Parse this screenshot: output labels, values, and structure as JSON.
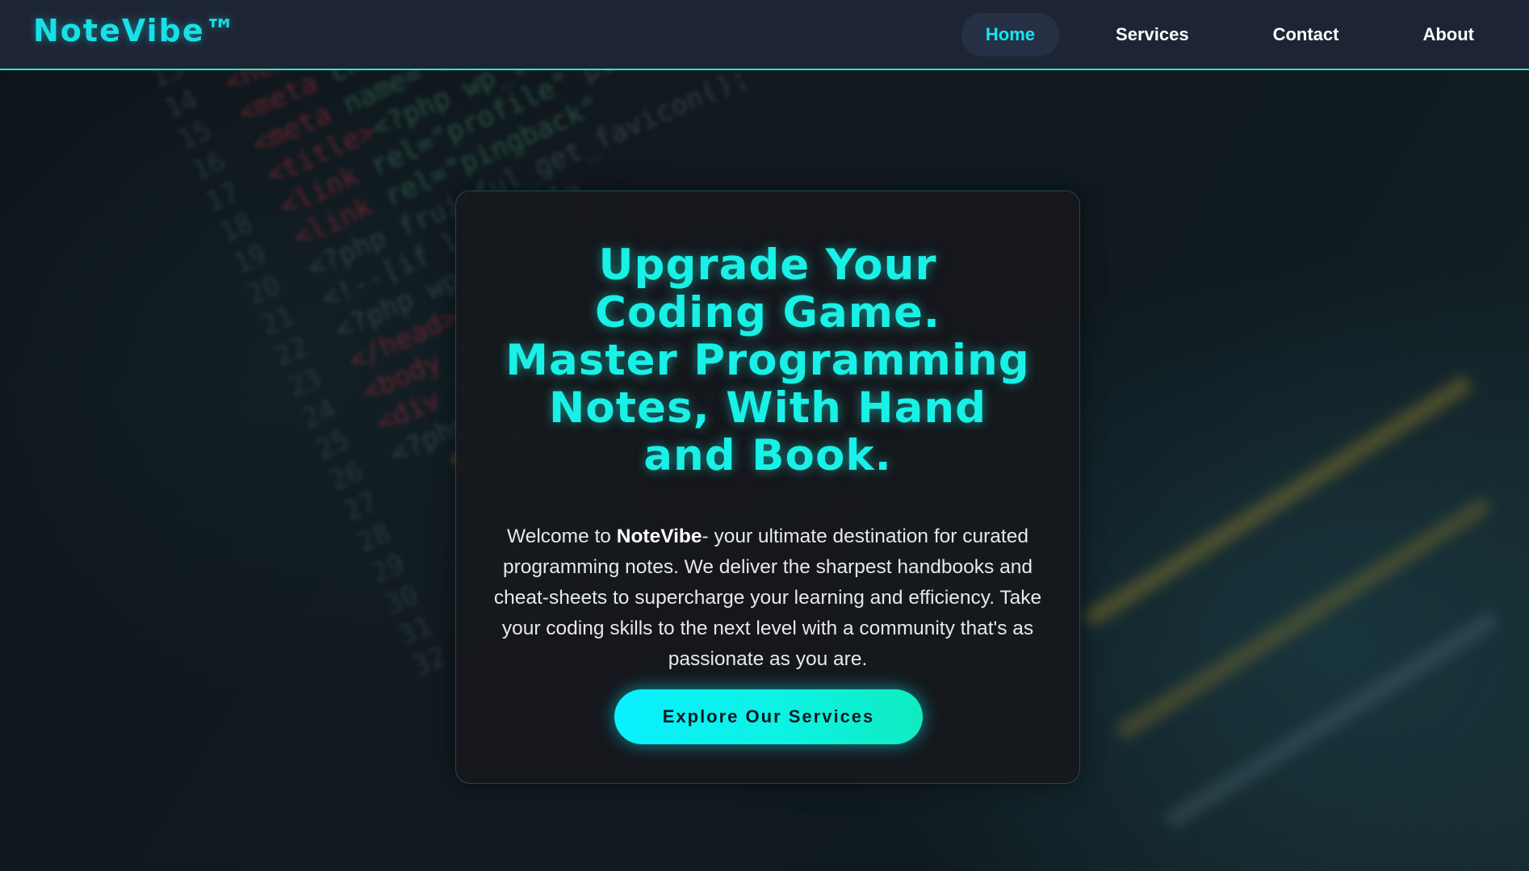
{
  "header": {
    "brand": "NoteVibe™",
    "nav": [
      {
        "label": "Home",
        "active": true
      },
      {
        "label": "Services",
        "active": false
      },
      {
        "label": "Contact",
        "active": false
      },
      {
        "label": "About",
        "active": false
      }
    ]
  },
  "hero": {
    "title_lines": [
      "Upgrade Your",
      "Coding Game.",
      "Master Programming",
      "Notes, With Hand",
      "and Book."
    ],
    "description": {
      "prefix": "Welcome to ",
      "brand": "NoteVibe",
      "suffix": "- your ultimate destination for curated programming notes. We deliver the sharpest handbooks and cheat-sheets to supercharge your learning and efficiency. Take your coding skills to the next level with a community that's as passionate as you are."
    },
    "cta_label": "Explore Our Services"
  },
  "colors": {
    "accent": "#18e6f0",
    "header_bg": "#1d2535",
    "header_border": "#2ee6c4",
    "card_bg": "#16181c",
    "cta_gradient_start": "#0af0ff",
    "cta_gradient_end": "#10ecc0"
  }
}
